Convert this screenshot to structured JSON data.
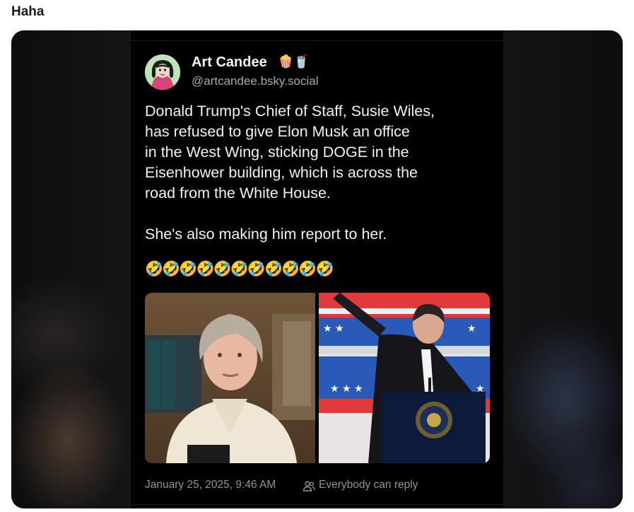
{
  "page": {
    "title": "Haha"
  },
  "post": {
    "author_name": "Art Candee",
    "author_emoji": "🍿🥤",
    "author_handle": "@artcandee.bsky.social",
    "text": "Donald Trump's Chief of Staff, Susie Wiles,\nhas refused to give Elon Musk an office\nin the West Wing, sticking DOGE in the\nEisenhower building, which is across the\nroad from the White House.\n\nShe's also making him report to her.",
    "emojis": "🤣🤣🤣🤣🤣🤣🤣🤣🤣🤣🤣",
    "timestamp": "January 25, 2025, 9:46 AM",
    "reply_setting": "Everybody can reply",
    "icons": {
      "reply": "people-icon"
    },
    "colors": {
      "background": "#000000",
      "text": "#f2f2f2",
      "muted": "#8e949e"
    }
  }
}
